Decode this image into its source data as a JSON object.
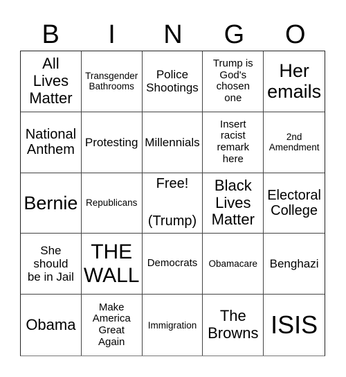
{
  "title_letters": [
    "B",
    "I",
    "N",
    "G",
    "O"
  ],
  "cells": [
    {
      "text": "All\nLives\nMatter",
      "size": "s-xl"
    },
    {
      "text": "Transgender\nBathrooms",
      "size": "s-xs"
    },
    {
      "text": "Police\nShootings",
      "size": "s-md"
    },
    {
      "text": "Trump is\nGod's\nchosen\none",
      "size": "s-sm"
    },
    {
      "text": "Her\nemails",
      "size": "s-xxl"
    },
    {
      "text": "National\nAnthem",
      "size": "s-lg"
    },
    {
      "text": "Protesting",
      "size": "s-md"
    },
    {
      "text": "Millennials",
      "size": "s-md"
    },
    {
      "text": "Insert\nracist\nremark\nhere",
      "size": "s-sm"
    },
    {
      "text": "2nd\nAmendment",
      "size": "s-xs"
    },
    {
      "text": "Bernie",
      "size": "s-xxl"
    },
    {
      "text": "Republicans",
      "size": "s-xs"
    },
    {
      "text": "Free!\n\n(Trump)",
      "size": "s-lg",
      "free": true
    },
    {
      "text": "Black\nLives\nMatter",
      "size": "s-xl"
    },
    {
      "text": "Electoral\nCollege",
      "size": "s-lg"
    },
    {
      "text": "She\nshould\nbe in Jail",
      "size": "s-md"
    },
    {
      "text": "THE\nWALL",
      "size": "s-huge"
    },
    {
      "text": "Democrats",
      "size": "s-sm"
    },
    {
      "text": "Obamacare",
      "size": "s-xs"
    },
    {
      "text": "Benghazi",
      "size": "s-md"
    },
    {
      "text": "Obama",
      "size": "s-xl"
    },
    {
      "text": "Make\nAmerica\nGreat\nAgain",
      "size": "s-sm"
    },
    {
      "text": "Immigration",
      "size": "s-xs"
    },
    {
      "text": "The\nBrowns",
      "size": "s-xl"
    },
    {
      "text": "ISIS",
      "size": "s-giant"
    }
  ]
}
